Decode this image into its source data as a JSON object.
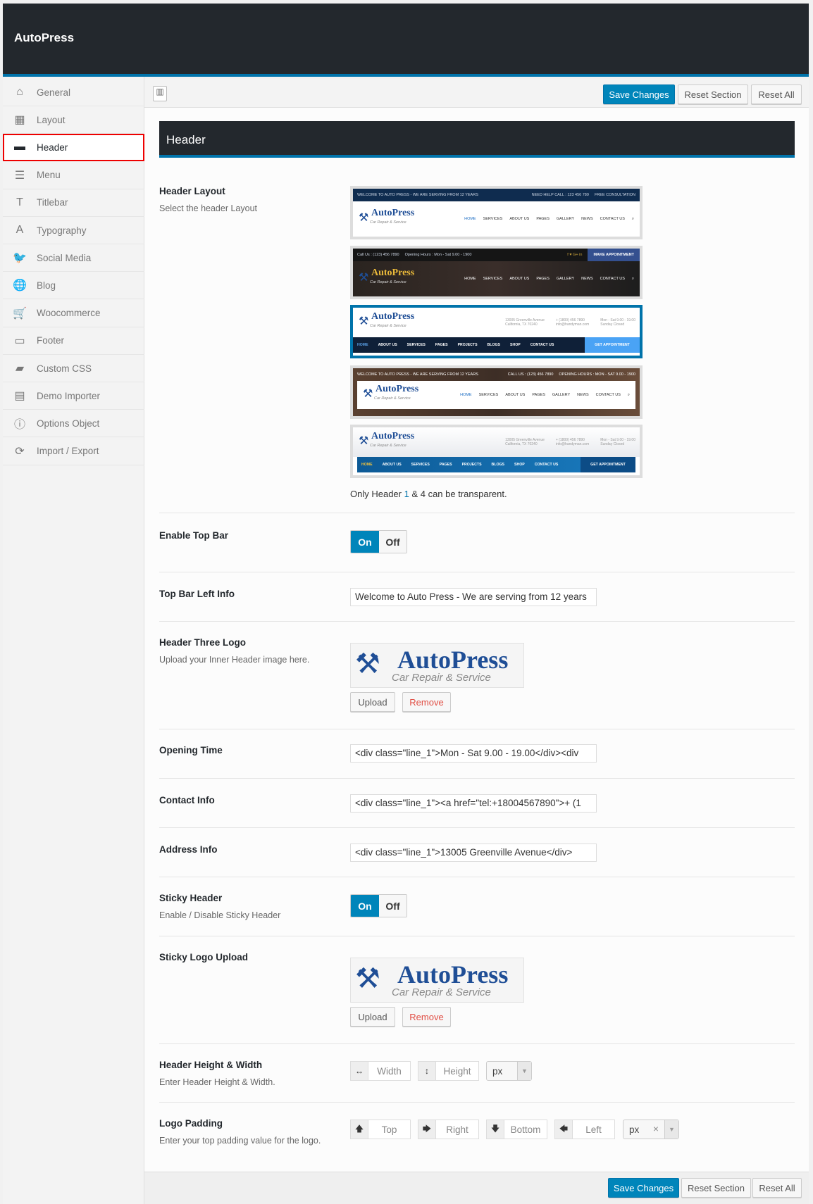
{
  "app": {
    "title": "AutoPress"
  },
  "colors": {
    "accent": "#0085ba",
    "dark": "#23282d",
    "active_outline": "#ee0000",
    "remove": "#e14d43"
  },
  "sidebar": {
    "items": [
      {
        "label": "General",
        "icon": "home-icon",
        "glyph": "⌂"
      },
      {
        "label": "Layout",
        "icon": "grid-icon",
        "glyph": "▦"
      },
      {
        "label": "Header",
        "icon": "header-icon",
        "glyph": "▬",
        "active": true
      },
      {
        "label": "Menu",
        "icon": "list-icon",
        "glyph": "☰"
      },
      {
        "label": "Titlebar",
        "icon": "text-height-icon",
        "glyph": "T"
      },
      {
        "label": "Typography",
        "icon": "font-icon",
        "glyph": "A"
      },
      {
        "label": "Social Media",
        "icon": "twitter-icon",
        "glyph": "🐦"
      },
      {
        "label": "Blog",
        "icon": "globe-icon",
        "glyph": "🌐"
      },
      {
        "label": "Woocommerce",
        "icon": "cart-icon",
        "glyph": "🛒"
      },
      {
        "label": "Footer",
        "icon": "monitor-icon",
        "glyph": "▭"
      },
      {
        "label": "Custom CSS",
        "icon": "css-icon",
        "glyph": "▰"
      },
      {
        "label": "Demo Importer",
        "icon": "window-icon",
        "glyph": "▤"
      },
      {
        "label": "Options Object",
        "icon": "info-icon",
        "glyph": "ⓘ"
      },
      {
        "label": "Import / Export",
        "icon": "refresh-icon",
        "glyph": "⟳"
      }
    ]
  },
  "toolbar": {
    "save": "Save Changes",
    "reset_section": "Reset Section",
    "reset_all": "Reset All"
  },
  "section": {
    "title": "Header"
  },
  "header_layout": {
    "label": "Header Layout",
    "desc": "Select the header Layout",
    "selected": 3,
    "note_pre": "Only Header ",
    "note_1": "1",
    "note_mid": " & 4 can be transparent.",
    "logo_title": "AutoPress",
    "logo_sub": "Car Repair & Service",
    "nav1": [
      "HOME",
      "SERVICES",
      "ABOUT US",
      "PAGES",
      "GALLERY",
      "NEWS",
      "CONTACT US"
    ],
    "nav3": [
      "HOME",
      "ABOUT US",
      "SERVICES",
      "PAGES",
      "PROJECTS",
      "BLOGS",
      "SHOP",
      "CONTACT US"
    ],
    "t1": {
      "left": "WELCOME TO AUTO PRESS - WE ARE SERVING FROM 12 YEARS",
      "call": "NEED HELP CALL : 123 456 789",
      "free": "FREE CONSULTATION"
    },
    "t2": {
      "call": "Call Us : (123) 456 7890",
      "hours": "Opening Hours : Mon - Sat 9.00 - 1900",
      "social": "f  ♥  G+  in",
      "btn": "MAKE APPOINTMENT"
    },
    "t3": {
      "addr1": "13005 Greenville Avenue",
      "addr2": "California, TX 70240",
      "ph1": "+ (1800) 456 7890",
      "ph2": "info@handyman.com",
      "h1": "Mon - Sat 9.00 - 19.00",
      "h2": "Sunday Closed",
      "btn": "GET APPOINTMENT"
    },
    "t4": {
      "left": "WELCOME TO AUTO PRESS - WE ARE SERVING FROM 12 YEARS",
      "call": "CALL US : (123) 456 7890",
      "hours": "OPENING HOURS : MON - SAT 9.00 - 1900"
    }
  },
  "top_bar": {
    "label": "Enable Top Bar",
    "on": "On",
    "off": "Off",
    "value": true
  },
  "top_bar_left": {
    "label": "Top Bar Left Info",
    "value": "Welcome to Auto Press - We are serving from 12 years"
  },
  "header_three_logo": {
    "label": "Header Three Logo",
    "desc": "Upload your Inner Header image here.",
    "upload": "Upload",
    "remove": "Remove"
  },
  "opening_time": {
    "label": "Opening Time",
    "value": "<div class=\"line_1\">Mon - Sat 9.00 - 19.00</div><div"
  },
  "contact_info": {
    "label": "Contact Info",
    "value": "<div class=\"line_1\"><a href=\"tel:+18004567890\">+ (1"
  },
  "address_info": {
    "label": "Address Info",
    "value": "<div class=\"line_1\">13005 Greenville Avenue</div>"
  },
  "sticky_header": {
    "label": "Sticky Header",
    "desc": "Enable / Disable Sticky Header",
    "on": "On",
    "off": "Off",
    "value": true
  },
  "sticky_logo": {
    "label": "Sticky Logo Upload",
    "upload": "Upload",
    "remove": "Remove"
  },
  "header_size": {
    "label": "Header Height & Width",
    "desc": "Enter Header Height & Width.",
    "width": "Width",
    "height": "Height",
    "unit": "px"
  },
  "logo_padding": {
    "label": "Logo Padding",
    "desc": "Enter your top padding value for the logo.",
    "top": "Top",
    "right": "Right",
    "bottom": "Bottom",
    "left": "Left",
    "unit": "px",
    "clear": "×"
  }
}
